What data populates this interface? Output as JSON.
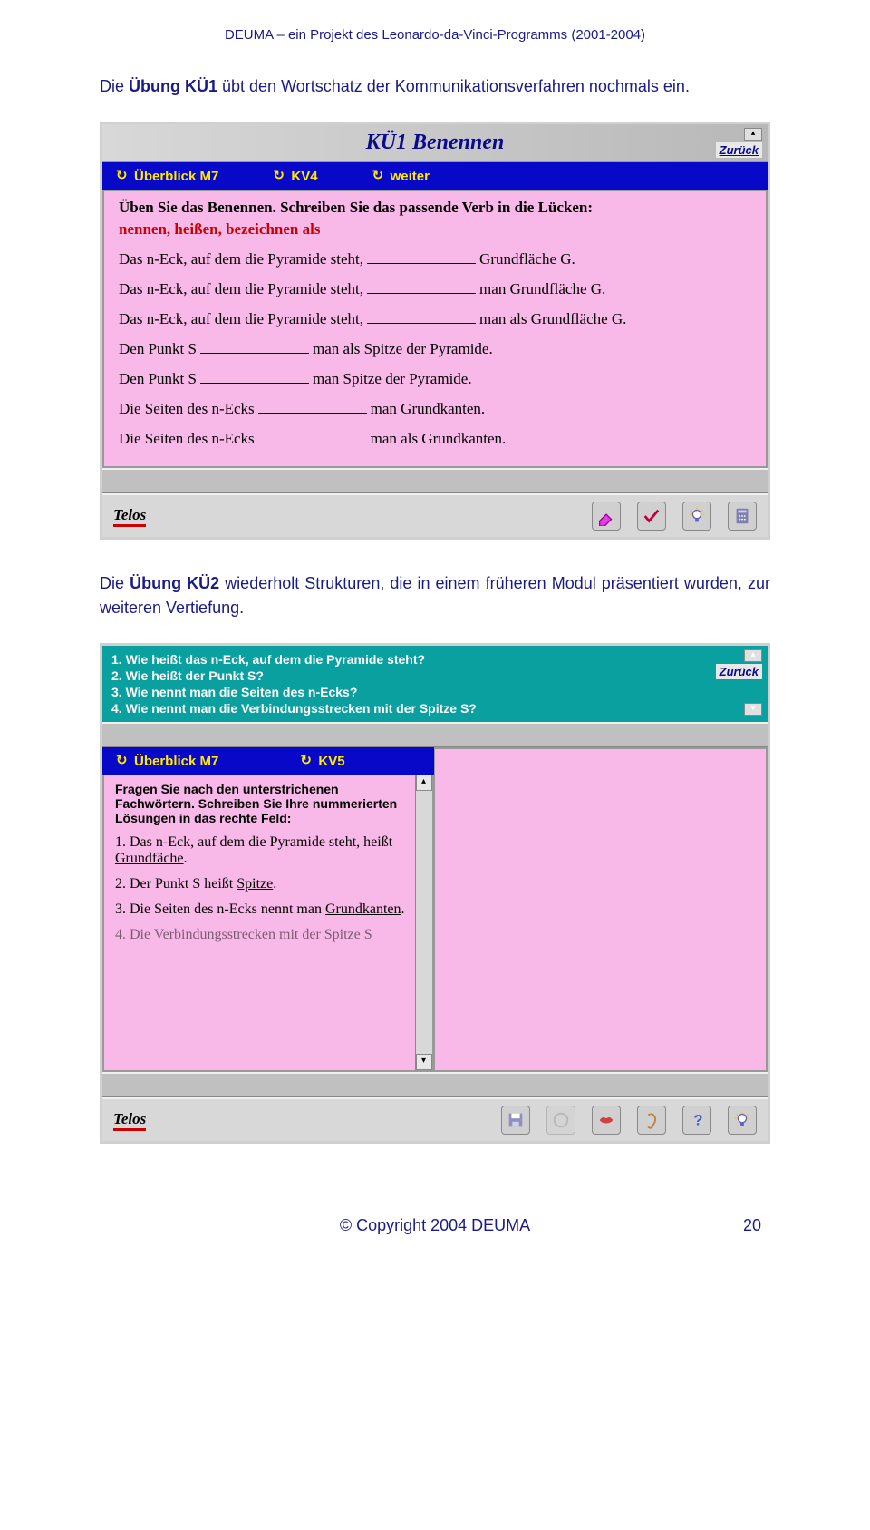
{
  "header": "DEUMA – ein Projekt des Leonardo-da-Vinci-Programms (2001-2004)",
  "para1_before": "Die ",
  "para1_bold": "Übung KÜ1",
  "para1_after": " übt den Wortschatz der Kommunikationsverfahren nochmals ein.",
  "window1": {
    "title": "KÜ1 Benennen",
    "zuruck": "Zurück",
    "nav": {
      "item1": "Überblick M7",
      "item2": "KV4",
      "item3": "weiter"
    },
    "instruction": "Üben Sie das Benennen. Schreiben Sie das passende Verb in die Lücken:",
    "hint": "nennen, heißen, bezeichnen als",
    "lines": {
      "l1a": "Das n-Eck, auf dem die Pyramide steht,",
      "l1b": "Grundfläche G.",
      "l2a": "Das n-Eck, auf dem die Pyramide steht,",
      "l2b": "man Grundfläche G.",
      "l3a": "Das n-Eck, auf dem die Pyramide steht,",
      "l3b": "man als Grundfläche G.",
      "l4a": "Den Punkt S",
      "l4b": "man als Spitze der Pyramide.",
      "l5a": "Den Punkt S",
      "l5b": "man Spitze der Pyramide.",
      "l6a": "Die Seiten des n-Ecks",
      "l6b": "man Grundkanten.",
      "l7a": "Die Seiten des n-Ecks",
      "l7b": "man als Grundkanten."
    },
    "logo": "Telos"
  },
  "para2_before": "Die ",
  "para2_bold": "Übung KÜ2",
  "para2_after": " wiederholt Strukturen, die in einem früheren Modul präsentiert wurden, zur weiteren Vertiefung.",
  "window2": {
    "questions": {
      "q1": "1. Wie heißt das n-Eck, auf dem die Pyramide steht?",
      "q2": "2. Wie heißt der Punkt S?",
      "q3": "3. Wie nennt man die Seiten des n-Ecks?",
      "q4": "4. Wie nennt man die Verbindungsstrecken mit der Spitze S?"
    },
    "zuruck": "Zurück",
    "nav": {
      "item1": "Überblick M7",
      "item2": "KV5"
    },
    "instruction": "Fragen Sie nach den unterstrichenen Fachwörtern. Schreiben Sie Ihre nummerierten Lösungen in das rechte Feld:",
    "items": {
      "i1a": "1. Das n-Eck, auf dem die Pyramide steht, heißt ",
      "i1b": "Grundfäche",
      "i1c": ".",
      "i2a": "2. Der Punkt S heißt ",
      "i2b": "Spitze",
      "i2c": ".",
      "i3a": "3. Die Seiten des n-Ecks nennt man ",
      "i3b": "Grundkanten",
      "i3c": ".",
      "i4": "4. Die Verbindungsstrecken mit der Spitze S"
    },
    "logo": "Telos"
  },
  "footer": {
    "copyright": "© Copyright 2004 DEUMA",
    "page": "20"
  }
}
